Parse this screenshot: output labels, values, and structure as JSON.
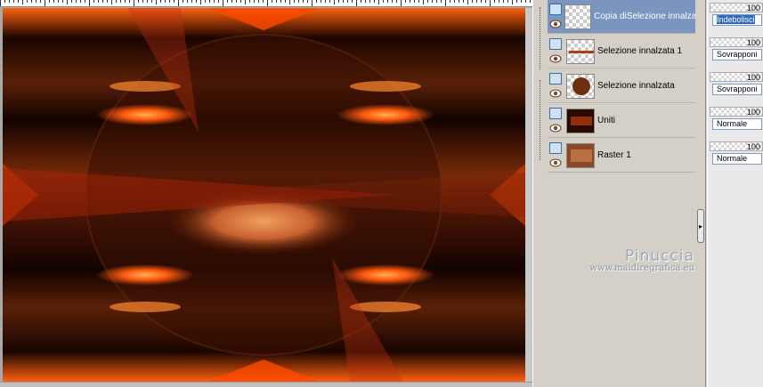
{
  "layers": [
    {
      "name": "Copia diSelezione innalzata",
      "selected": true
    },
    {
      "name": "Selezione innalzata 1",
      "selected": false
    },
    {
      "name": "Selezione innalzata",
      "selected": false
    },
    {
      "name": "Uniti",
      "selected": false
    },
    {
      "name": "Raster 1",
      "selected": false
    }
  ],
  "properties": [
    {
      "opacity": "100",
      "blend": "Indebolisci"
    },
    {
      "opacity": "100",
      "blend": "Sovrapponi"
    },
    {
      "opacity": "100",
      "blend": "Sovrapponi"
    },
    {
      "opacity": "100",
      "blend": "Normale"
    },
    {
      "opacity": "100",
      "blend": "Normale"
    }
  ],
  "watermark": {
    "name": "Pinuccia",
    "url": "www.maidiregrafica.eu"
  },
  "colors": {
    "selected_row": "#7a96c0",
    "canvas_dark": "#1a0800",
    "canvas_orange": "#ff5a10"
  }
}
